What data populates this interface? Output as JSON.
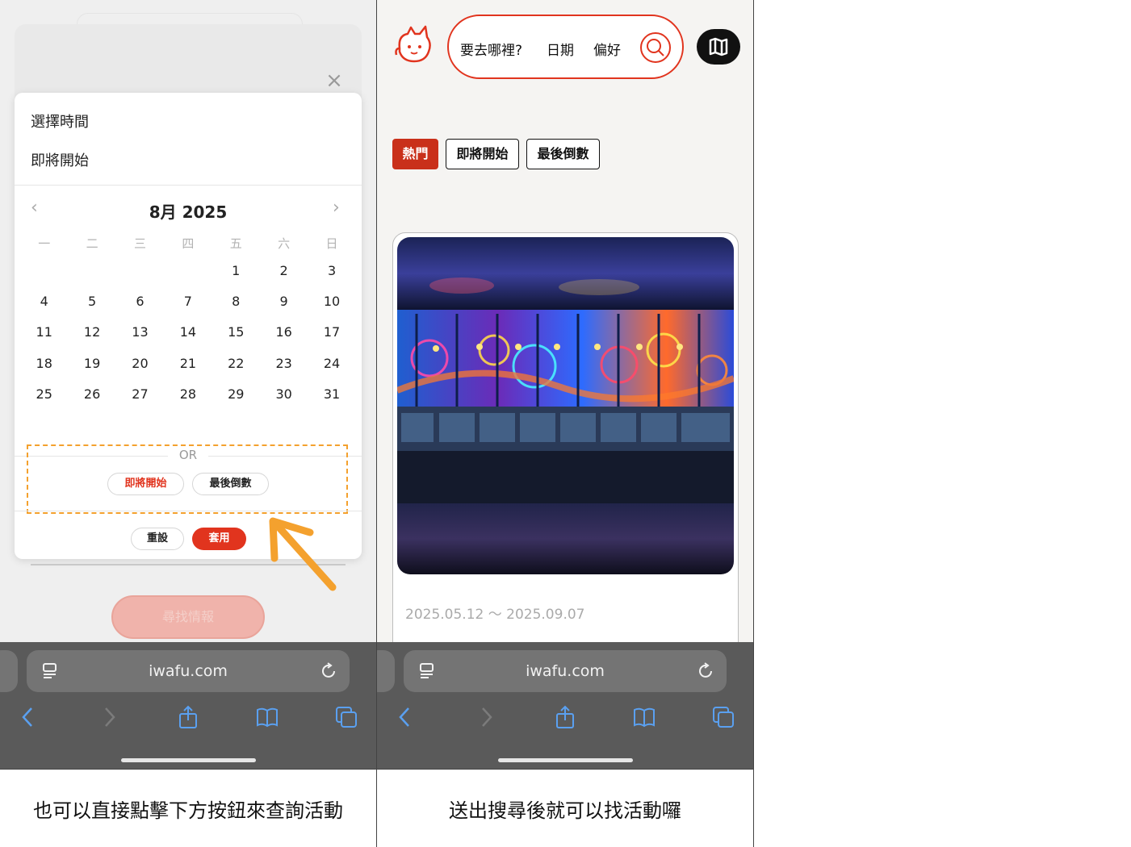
{
  "left": {
    "calendar_dropdown": {
      "option_select_time": "選擇時間",
      "option_upcoming": "即將開始",
      "month_title": "8月 2025",
      "prev_glyph": "‹",
      "next_glyph": "›",
      "weekdays": [
        "一",
        "二",
        "三",
        "四",
        "五",
        "六",
        "日"
      ],
      "leading_blanks": 4,
      "days": [
        "1",
        "2",
        "3",
        "4",
        "5",
        "6",
        "7",
        "8",
        "9",
        "10",
        "11",
        "12",
        "13",
        "14",
        "15",
        "16",
        "17",
        "18",
        "19",
        "20",
        "21",
        "22",
        "23",
        "24",
        "25",
        "26",
        "27",
        "28",
        "29",
        "30",
        "31"
      ],
      "or_label": "OR",
      "chip_upcoming": "即將開始",
      "chip_last_countdown": "最後倒數",
      "reset_label": "重設",
      "apply_label": "套用"
    },
    "close_glyph": "×",
    "find_button": "尋找情報",
    "url": "iwafu.com",
    "caption": "也可以直接點擊下方按鈕來查詢活動"
  },
  "right": {
    "search": {
      "where": "要去哪裡?",
      "date": "日期",
      "prefs": "偏好"
    },
    "tags": {
      "hot": "熱門",
      "upcoming": "即將開始",
      "last_countdown": "最後倒數"
    },
    "card": {
      "date_range": "2025.05.12 〜 2025.09.07"
    },
    "url": "iwafu.com",
    "caption": "送出搜尋後就可以找活動囉"
  },
  "colors": {
    "brand_red": "#e1341e",
    "dash_orange": "#f4a12e",
    "chrome_gray": "#5a5a5a",
    "ios_blue": "#5aa0f0"
  },
  "icons": [
    "chevron-left-icon",
    "chevron-right-icon",
    "close-icon",
    "tabs-list-icon",
    "reload-icon",
    "back-icon",
    "forward-icon",
    "share-icon",
    "bookmarks-icon",
    "tabs-icon",
    "mascot-logo",
    "search-icon",
    "map-icon",
    "annotation-arrow"
  ]
}
